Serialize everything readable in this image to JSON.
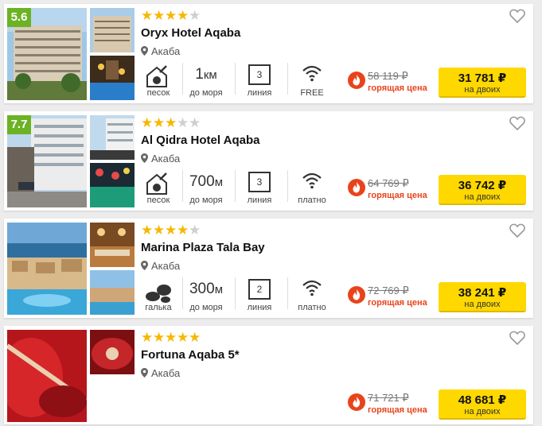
{
  "currency_sign": "₽",
  "colors": {
    "rating_badge": "#6bb324",
    "star_on": "#f5b800",
    "star_off": "#cfcfcf",
    "hot": "#e8441b",
    "button": "#ffd800"
  },
  "hotels": [
    {
      "rating": "5.6",
      "stars_on": 4,
      "stars": [
        "on",
        "on",
        "on",
        "on",
        "off"
      ],
      "name": "Oryx Hotel Aqaba",
      "city": "Акаба",
      "beach_type": "песок",
      "beach_icon": "sand-beach-icon",
      "distance_value": "1",
      "distance_unit": "км",
      "distance_label": "до моря",
      "line_number": "3",
      "line_label": "линия",
      "wifi_label": "FREE",
      "old_price": "58 119 ₽",
      "hot_label": "горящая цена",
      "price": "31 781 ₽",
      "price_note": "на двоих"
    },
    {
      "rating": "7.7",
      "stars_on": 3,
      "stars": [
        "on",
        "on",
        "on",
        "off",
        "off"
      ],
      "name": "Al Qidra Hotel Aqaba",
      "city": "Акаба",
      "beach_type": "песок",
      "beach_icon": "sand-beach-icon",
      "distance_value": "700",
      "distance_unit": "м",
      "distance_label": "до моря",
      "line_number": "3",
      "line_label": "линия",
      "wifi_label": "платно",
      "old_price": "64 769 ₽",
      "hot_label": "горящая цена",
      "price": "36 742 ₽",
      "price_note": "на двоих"
    },
    {
      "rating": "",
      "stars_on": 4,
      "stars": [
        "on",
        "on",
        "on",
        "on",
        "off"
      ],
      "name": "Marina Plaza Tala Bay",
      "city": "Акаба",
      "beach_type": "галька",
      "beach_icon": "pebble-beach-icon",
      "distance_value": "300",
      "distance_unit": "м",
      "distance_label": "до моря",
      "line_number": "2",
      "line_label": "линия",
      "wifi_label": "платно",
      "old_price": "72 769 ₽",
      "hot_label": "горящая цена",
      "price": "38 241 ₽",
      "price_note": "на двоих"
    },
    {
      "rating": "",
      "stars_on": 5,
      "stars": [
        "on",
        "on",
        "on",
        "on",
        "on"
      ],
      "name": "Fortuna Aqaba 5*",
      "city": "Акаба",
      "old_price": "71 721 ₽",
      "hot_label": "горящая цена",
      "price": "48 681 ₽",
      "price_note": "на двоих"
    }
  ]
}
